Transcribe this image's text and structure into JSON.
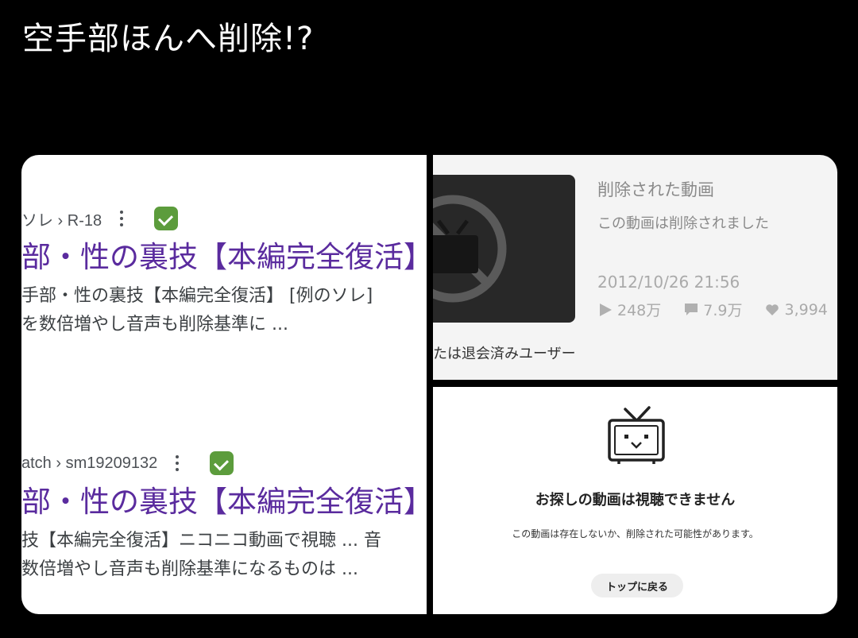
{
  "post": {
    "title": "空手部ほんへ削除!?"
  },
  "search_results": [
    {
      "breadcrumb": "ソレ › R-18",
      "title": "部・性の裏技【本編完全復活】",
      "snippet_lines": [
        "手部・性の裏技【本編完全復活】 [例のソレ]",
        "を数倍増やし音声も削除基準に ..."
      ]
    },
    {
      "breadcrumb": "atch › sm19209132",
      "title": "部・性の裏技【本編完全復活】",
      "snippet_lines": [
        "技【本編完全復活】ニコニコ動画で視聴 ... 音",
        "数倍増やし音声も削除基準になるものは ..."
      ]
    }
  ],
  "deleted_video": {
    "title": "削除された動画",
    "description": "この動画は削除されました",
    "date": "2012/10/26 21:56",
    "views": "248万",
    "comments": "7.9万",
    "likes": "3,994",
    "uploader": "たは退会済みユーザー"
  },
  "unavailable": {
    "heading": "お探しの動画は視聴できません",
    "message": "この動画は存在しないか、削除された可能性があります。",
    "button_label": "トップに戻る"
  },
  "icons": {
    "kebab": "more-vert-icon",
    "verified": "check-badge-icon",
    "deleted_thumb": "no-tv-icon",
    "play": "play-icon",
    "comment": "comment-icon",
    "like": "heart-icon",
    "mascot": "niconico-tv-icon"
  },
  "colors": {
    "link_visited": "#5a2b9e",
    "verified": "#5c9c3c"
  }
}
